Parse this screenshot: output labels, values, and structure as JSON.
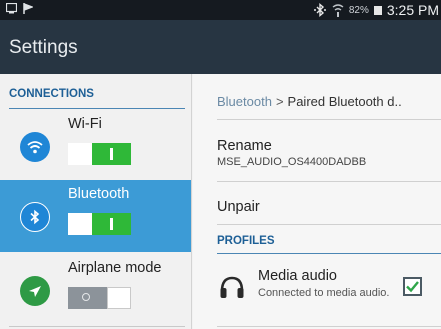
{
  "status_bar": {
    "battery_percent": "82%",
    "time": "3:25 PM"
  },
  "action_bar": {
    "title": "Settings"
  },
  "left_pane": {
    "section_header": "CONNECTIONS",
    "items": [
      {
        "label": "Wi-Fi",
        "icon": "wifi-icon",
        "toggle": "on",
        "selected": false,
        "icon_color": "#1f86d6"
      },
      {
        "label": "Bluetooth",
        "icon": "bluetooth-icon",
        "toggle": "on",
        "selected": true,
        "icon_color": "#1f86d6"
      },
      {
        "label": "Airplane mode",
        "icon": "airplane-icon",
        "toggle": "off",
        "selected": false,
        "icon_color": "#2e9a45"
      }
    ]
  },
  "right_pane": {
    "breadcrumb": {
      "parent": "Bluetooth",
      "separator": ">",
      "current": "Paired Bluetooth d.."
    },
    "rename": {
      "label": "Rename",
      "value": "MSE_AUDIO_OS4400DADBB"
    },
    "unpair_label": "Unpair",
    "profiles_header": "PROFILES",
    "media_audio": {
      "title": "Media audio",
      "subtitle": "Connected to media audio.",
      "checked": true
    }
  },
  "colors": {
    "accent": "#3c9bd6",
    "toggle_on": "#2fb838",
    "header_blue": "#1d5f96",
    "action_bar": "#273542"
  }
}
